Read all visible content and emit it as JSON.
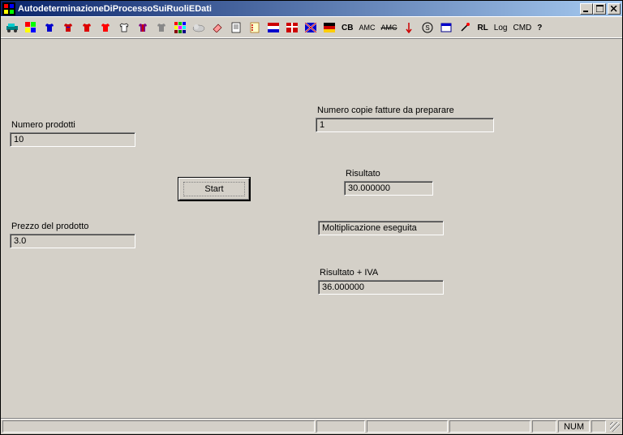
{
  "window": {
    "title": "AutodeterminazioneDiProcessoSuiRuoliEDati"
  },
  "toolbar": {
    "cb": "CB",
    "amc1": "AMC",
    "amc2": "AMC",
    "rl": "RL",
    "log": "Log",
    "cmd": "CMD",
    "help": "?"
  },
  "form": {
    "numero_prodotti_label": "Numero prodotti",
    "numero_prodotti_value": "10",
    "numero_copie_label": "Numero copie fatture da preparare",
    "numero_copie_value": "1",
    "start_label": "Start",
    "prezzo_label": "Prezzo del prodotto",
    "prezzo_value": "3.0",
    "risultato_label": "Risultato",
    "risultato_value": "30.000000",
    "moltiplicazione_status": "Moltiplicazione eseguita",
    "risultato_iva_label": "Risultato + IVA",
    "risultato_iva_value": "36.000000"
  },
  "statusbar": {
    "num": "NUM"
  }
}
